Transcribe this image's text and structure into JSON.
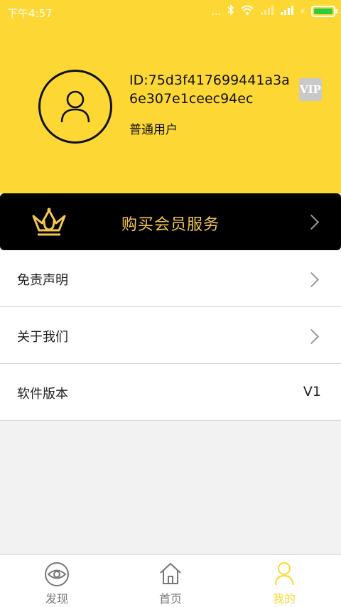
{
  "status_bar": {
    "time": "下午4:57",
    "signal_dots": "...",
    "charge_icon": "⚡"
  },
  "profile": {
    "user_id": "ID:75d3f417699441a3a6e307e1ceec94ec",
    "user_level": "普通用户",
    "vip_badge": "VIP",
    "avatar_icon": "user-icon"
  },
  "vip_banner": {
    "label": "购买会员服务",
    "icon": "crown-icon"
  },
  "menu": {
    "disclaimer": {
      "label": "免责声明"
    },
    "about": {
      "label": "关于我们"
    },
    "version": {
      "label": "软件版本",
      "value": "V1"
    }
  },
  "bottom_nav": {
    "discover": {
      "label": "发现",
      "icon": "eye-icon"
    },
    "home": {
      "label": "首页",
      "icon": "house-icon"
    },
    "mine": {
      "label": "我的",
      "icon": "user-icon",
      "active": true
    }
  },
  "colors": {
    "accent": "#fdd835",
    "banner_text": "#f5c84a",
    "banner_bg": "#000000"
  }
}
